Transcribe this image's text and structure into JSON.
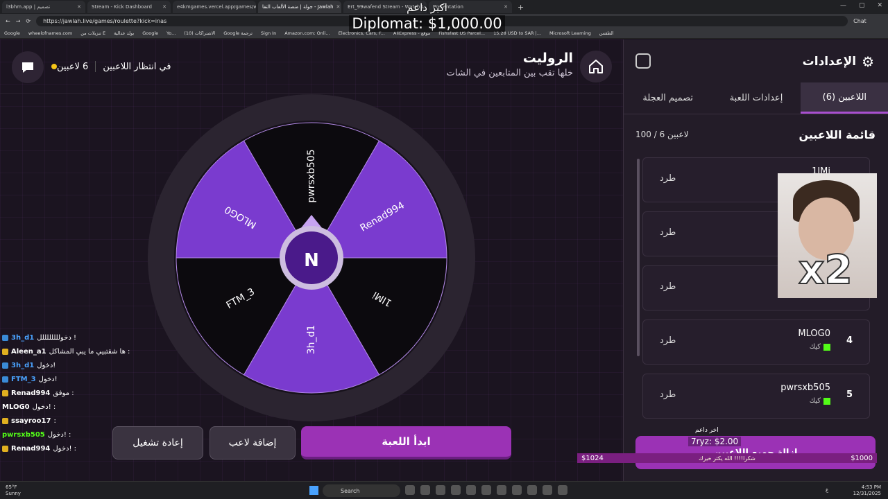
{
  "browser": {
    "tabs": [
      {
        "label": "l3bhm.app | تصميم",
        "active": false
      },
      {
        "label": "Stream - Kick Dashboard",
        "active": false
      },
      {
        "label": "e4kmgames.vercel.app/games/w",
        "active": false
      },
      {
        "label": "جولة | منصة الألعاب التفا - Jawlah",
        "active": true
      },
      {
        "label": "Ert_99wafend Stream - Watch L",
        "active": false
      },
      {
        "label": "Presentation",
        "active": false
      }
    ],
    "url": "https://jawlah.live/games/roulette?kick=inas",
    "bookmarks": [
      "Google",
      "wheelofnames.com",
      "تنزيلات من E",
      "بولد عدالية",
      "Google",
      "Yo...",
      "(10) الاشتراكات",
      "Google ترجمة",
      "Sign In",
      "Amazon.com: Onli...",
      "Electronics, Cars, F...",
      "AliExpress - موقع",
      "Fishsfast US Parcel...",
      "15.28 USD to SAR |...",
      "Microsoft Learning",
      "الطقس"
    ],
    "chat_label": "Chat"
  },
  "overlay": {
    "top_line": "اكبر داعم",
    "top_amount": "Diplomat: $1,000.00"
  },
  "header": {
    "title": "الروليت",
    "subtitle": "خلها تقب بين المتابعين في الشات",
    "status_waiting": "في انتظار اللاعبين",
    "status_players": "6 لاعبين"
  },
  "wheel": {
    "segments": [
      {
        "name": "pwrsxb505",
        "color": "#0c0a0e"
      },
      {
        "name": "Renad994",
        "color": "#7a3bcf"
      },
      {
        "name": "1IMi",
        "color": "#0c0a0e"
      },
      {
        "name": "3h_d1",
        "color": "#7a3bcf"
      },
      {
        "name": "FTM_3",
        "color": "#0c0a0e"
      },
      {
        "name": "MLOG0",
        "color": "#7a3bcf"
      }
    ],
    "center_letter": "N"
  },
  "chat": [
    {
      "user": "3h_d1",
      "text": "دخوللللللللل !",
      "badge": "b",
      "color": "#4aa3ff"
    },
    {
      "user": "Aleen_a1",
      "text": "ها شقتبيي ما يبي المشاكل :",
      "badge": "y",
      "color": "#ffffff"
    },
    {
      "user": "3h_d1",
      "text": "دخول!",
      "badge": "b",
      "color": "#4aa3ff"
    },
    {
      "user": "FTM_3",
      "text": "دخول!",
      "badge": "b",
      "color": "#4aa3ff"
    },
    {
      "user": "Renad994",
      "text": "موفق :",
      "badge": "y",
      "color": "#ffffff"
    },
    {
      "user": "MLOG0",
      "text": "دخول! :",
      "badge": "",
      "color": "#ffffff"
    },
    {
      "user": "ssayroo17",
      "text": ":",
      "badge": "y",
      "color": "#ffffff"
    },
    {
      "user": "pwrsxb505",
      "text": "دخول! :",
      "badge": "",
      "color": "#53fc18"
    },
    {
      "user": "Renad994",
      "text": "دخول! :",
      "badge": "y",
      "color": "#ffffff"
    }
  ],
  "buttons": {
    "start": "ابدأ اللعبة",
    "add_player": "إضافة لاعب",
    "restart": "إعادة تشغيل"
  },
  "sidebar": {
    "title": "الإعدادات",
    "tabs": [
      "اللاعبين (6)",
      "إعدادات اللعبة",
      "تصميم العجلة"
    ],
    "list_title": "قائمة اللاعبين",
    "list_count": "100 / 6 لاعبين",
    "kick_label": "طرد",
    "platform_label": "كيك",
    "players": [
      {
        "num": "1",
        "name": "1IMi"
      },
      {
        "num": "2",
        "name": ""
      },
      {
        "num": "3",
        "name": "FTM_3"
      },
      {
        "num": "4",
        "name": "MLOG0"
      },
      {
        "num": "5",
        "name": "pwrsxb505"
      }
    ],
    "bottom_button": "إزالة جميع اللاعبين"
  },
  "webcam": {
    "badge": "x2"
  },
  "donation": {
    "label": "اخر داعم",
    "amount": "7ryz: $2.00",
    "bar_left": "$1024",
    "bar_mid": "شكرا!!!! الله يكثر خيرك",
    "bar_right": "$1000"
  },
  "taskbar": {
    "weather_temp": "65°F",
    "weather_desc": "Sunny",
    "search": "Search",
    "time": "4:53 PM",
    "date": "12/31/2025",
    "lang": "ع"
  }
}
